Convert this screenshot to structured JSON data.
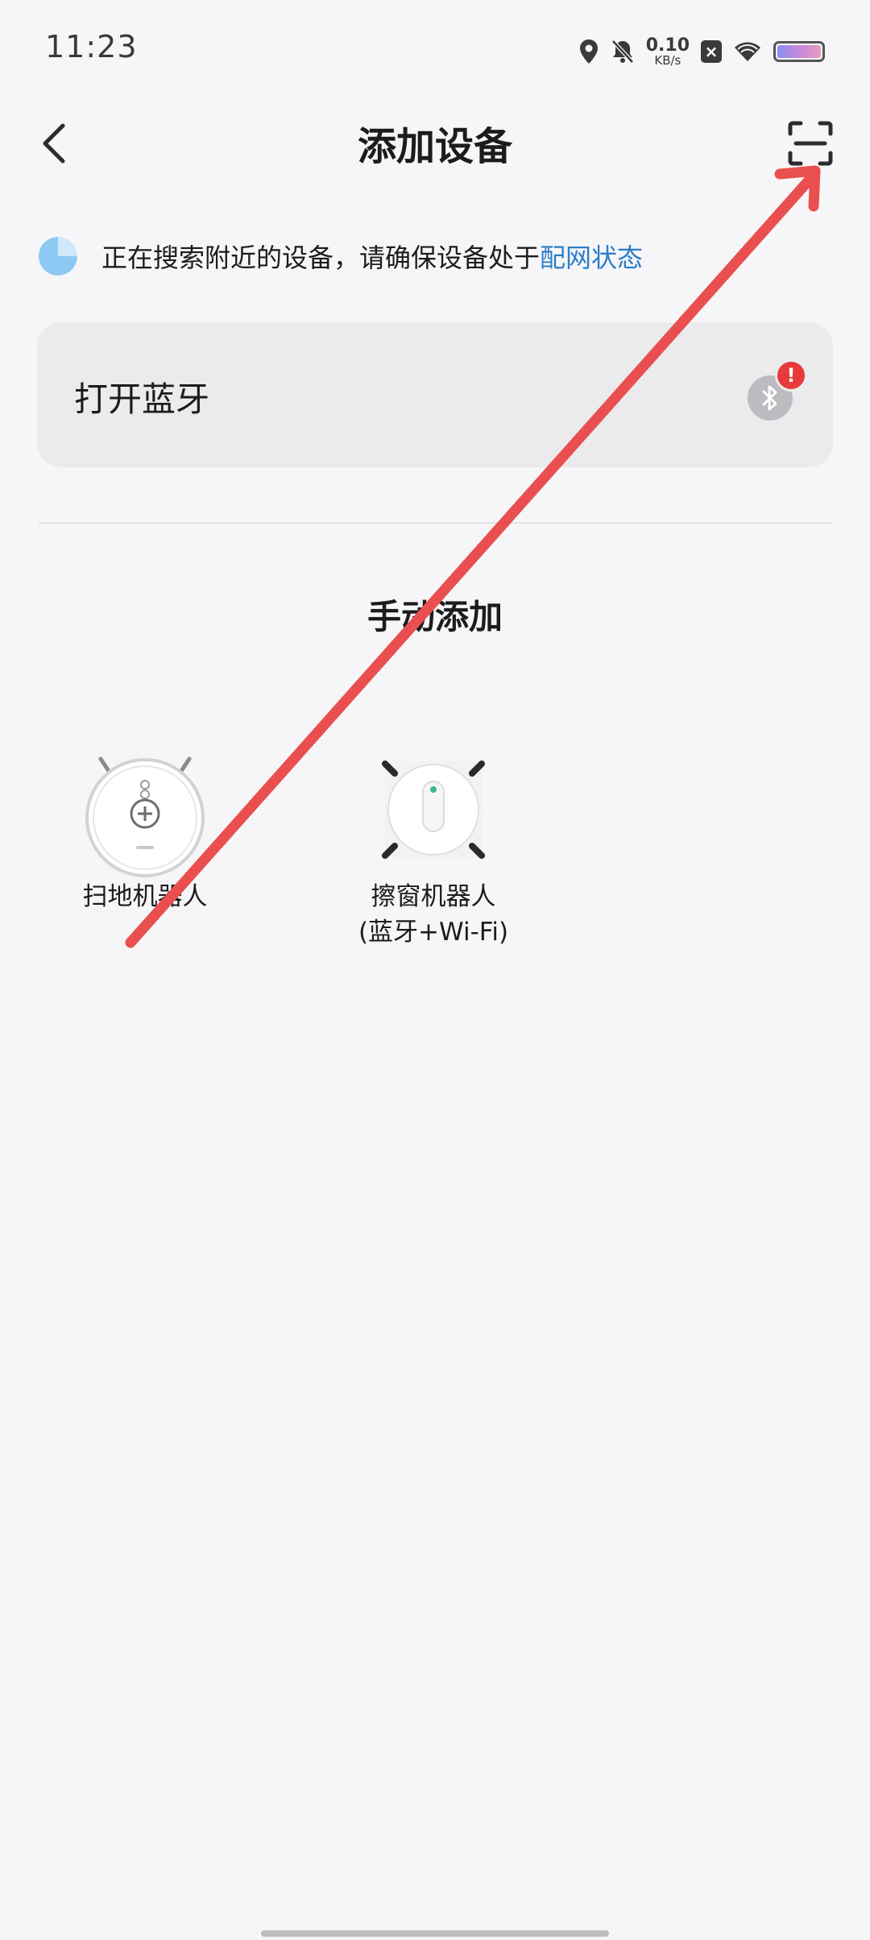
{
  "status_bar": {
    "time": "11:23",
    "net_speed_value": "0.10",
    "net_speed_unit": "KB/s",
    "icons": [
      "location-icon",
      "mute-bell-icon",
      "sim-blocked-icon",
      "wifi-icon",
      "battery-icon"
    ]
  },
  "header": {
    "title": "添加设备",
    "back_icon": "chevron-left-icon",
    "scan_icon": "scan-frame-icon"
  },
  "search": {
    "text": "正在搜索附近的设备，请确保设备处于",
    "link": "配网状态"
  },
  "bluetooth": {
    "label": "打开蓝牙",
    "badge": "!"
  },
  "manual": {
    "title": "手动添加"
  },
  "devices": [
    {
      "name": "扫地机器人",
      "icon": "robot-vacuum-icon"
    },
    {
      "name_line1": "擦窗机器人",
      "name_line2": "(蓝牙+Wi-Fi)",
      "icon": "window-robot-icon"
    }
  ],
  "colors": {
    "link": "#2c7dc9",
    "alert": "#e83a3a",
    "annotation_arrow": "#ea4f4f"
  }
}
